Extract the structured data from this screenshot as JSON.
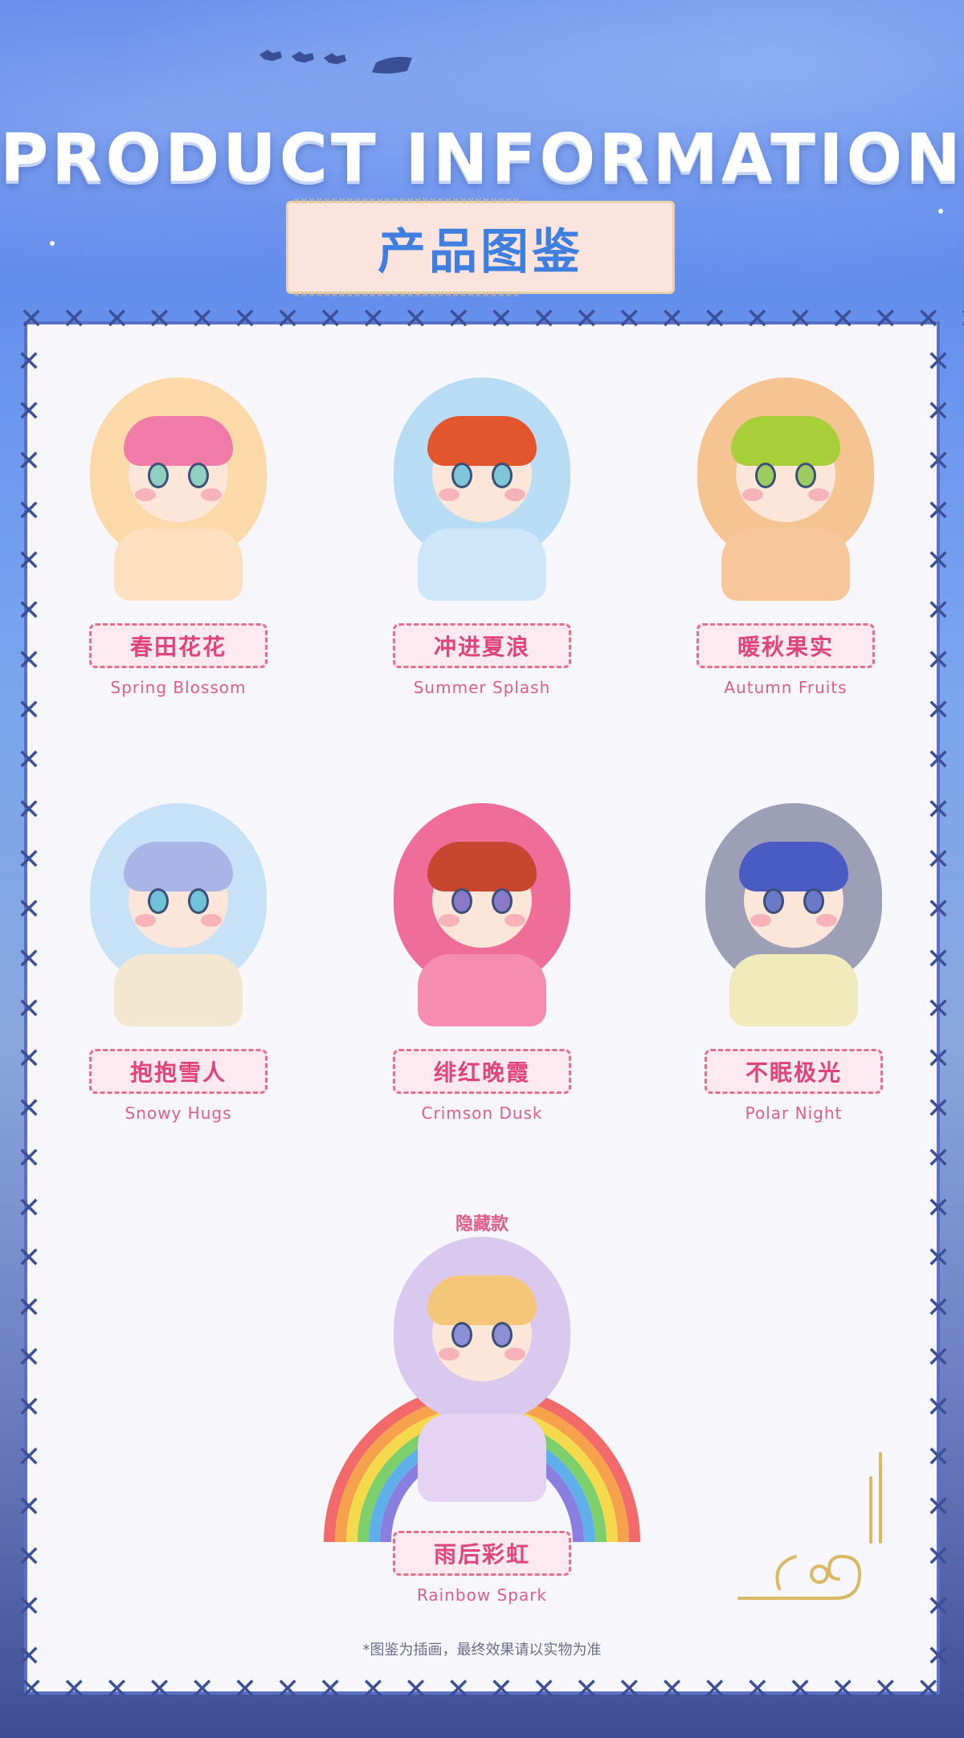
{
  "header": {
    "title": "PRODUCT INFORMATION",
    "subtitle": "产品图鉴"
  },
  "colors": {
    "card_border": "#3c4f97",
    "label_pink": "#e0447a",
    "subtitle_blue": "#3f7fe0"
  },
  "products": [
    {
      "cn": "春田花花",
      "en": "Spring Blossom",
      "hood": "#fbd9a8",
      "hair": "#f07aa8",
      "body": "#fde0c0",
      "eye": "#8fd0c0"
    },
    {
      "cn": "冲进夏浪",
      "en": "Summer Splash",
      "hood": "#b9dcf5",
      "hair": "#e2552d",
      "body": "#cfe6fa",
      "eye": "#7fc6d8"
    },
    {
      "cn": "暖秋果实",
      "en": "Autumn Fruits",
      "hood": "#f6c493",
      "hair": "#a8cf3a",
      "body": "#f7c79b",
      "eye": "#9ccb62"
    },
    {
      "cn": "抱抱雪人",
      "en": "Snowy Hugs",
      "hood": "#c7e2f6",
      "hair": "#a9b5e6",
      "body": "#f4e7d2",
      "eye": "#6fc2d9"
    },
    {
      "cn": "绯红晚霞",
      "en": "Crimson Dusk",
      "hood": "#ef6e99",
      "hair": "#c6462f",
      "body": "#f58db0",
      "eye": "#8a79c9"
    },
    {
      "cn": "不眠极光",
      "en": "Polar Night",
      "hood": "#9c9fb6",
      "hair": "#4a5cc4",
      "body": "#f1eaba",
      "eye": "#6b79c9"
    }
  ],
  "hidden": {
    "tag": "隐藏款",
    "cn": "雨后彩虹",
    "en": "Rainbow Spark",
    "hood": "#d9c9ee",
    "hair": "#f4c67a",
    "body": "#e6d2f2",
    "eye": "#8d8fd6"
  },
  "footnote": "*图鉴为插画，最终效果请以实物为准"
}
